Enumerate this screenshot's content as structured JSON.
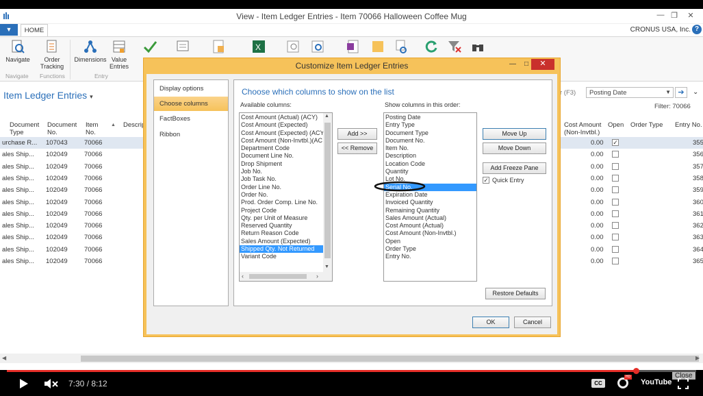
{
  "window": {
    "title": "View - Item Ledger Entries - Item 70066 Halloween Coffee Mug"
  },
  "ribbon_tabs": {
    "home": "HOME",
    "company": "CRONUS USA, Inc."
  },
  "ribbon": {
    "navigate": "Navigate",
    "order_tracking": "Order Tracking",
    "dimensions": "Dimensions",
    "value_entries": "Value Entries",
    "group_navigate": "Navigate",
    "group_functions": "Functions",
    "group_entry": "Entry"
  },
  "page": {
    "title": "Item Ledger Entries",
    "filter_hint": "r (F3)",
    "filter_field": "Posting Date",
    "filter_label": "Filter: 70066"
  },
  "grid": {
    "headers": {
      "entry_type": "Document Type",
      "doc_no": "Document No.",
      "item_no": "Item No.",
      "descr": "Descrip",
      "cost_amt": "Cost Amount (Non-Invtbl.)",
      "open": "Open",
      "order_type": "Order Type",
      "entry_no": "Entry No."
    },
    "rows": [
      {
        "type": "urchase R...",
        "doc": "107043",
        "item": "70066",
        "cost": "0.00",
        "open": true,
        "entry": "355"
      },
      {
        "type": "ales Ship...",
        "doc": "102049",
        "item": "70066",
        "cost": "0.00",
        "open": false,
        "entry": "356"
      },
      {
        "type": "ales Ship...",
        "doc": "102049",
        "item": "70066",
        "cost": "0.00",
        "open": false,
        "entry": "357"
      },
      {
        "type": "ales Ship...",
        "doc": "102049",
        "item": "70066",
        "cost": "0.00",
        "open": false,
        "entry": "358"
      },
      {
        "type": "ales Ship...",
        "doc": "102049",
        "item": "70066",
        "cost": "0.00",
        "open": false,
        "entry": "359"
      },
      {
        "type": "ales Ship...",
        "doc": "102049",
        "item": "70066",
        "cost": "0.00",
        "open": false,
        "entry": "360"
      },
      {
        "type": "ales Ship...",
        "doc": "102049",
        "item": "70066",
        "cost": "0.00",
        "open": false,
        "entry": "361"
      },
      {
        "type": "ales Ship...",
        "doc": "102049",
        "item": "70066",
        "cost": "0.00",
        "open": false,
        "entry": "362"
      },
      {
        "type": "ales Ship...",
        "doc": "102049",
        "item": "70066",
        "cost": "0.00",
        "open": false,
        "entry": "363"
      },
      {
        "type": "ales Ship...",
        "doc": "102049",
        "item": "70066",
        "cost": "0.00",
        "open": false,
        "entry": "364"
      },
      {
        "type": "ales Ship...",
        "doc": "102049",
        "item": "70066",
        "cost": "0.00",
        "open": false,
        "entry": "365"
      }
    ]
  },
  "dialog": {
    "title": "Customize Item Ledger Entries",
    "nav": [
      "Display options",
      "Choose columns",
      "FactBoxes",
      "Ribbon"
    ],
    "heading": "Choose which columns to show on the list",
    "available_label": "Available columns:",
    "shown_label": "Show columns in this order:",
    "available": [
      "Cost Amount (Actual) (ACY)",
      "Cost Amount (Expected)",
      "Cost Amount (Expected) (ACY",
      "Cost Amount (Non-Invtbl.)(AC",
      "Department Code",
      "Document Line No.",
      "Drop Shipment",
      "Job No.",
      "Job Task No.",
      "Order Line No.",
      "Order No.",
      "Prod. Order Comp. Line No.",
      "Project Code",
      "Qty. per Unit of Measure",
      "Reserved Quantity",
      "Return Reason Code",
      "Sales Amount (Expected)",
      "Shipped Qty. Not Returned",
      "Variant Code"
    ],
    "shown": [
      "Posting Date",
      "Entry Type",
      "Document Type",
      "Document No.",
      "Item No.",
      "Description",
      "Location Code",
      "Quantity",
      "Lot No.",
      "Serial No.",
      "Expiration Date",
      "Invoiced Quantity",
      "Remaining Quantity",
      "Sales Amount (Actual)",
      "Cost Amount (Actual)",
      "Cost Amount (Non-Invtbl.)",
      "Open",
      "Order Type",
      "Entry No."
    ],
    "add": "Add >>",
    "remove": "<< Remove",
    "move_up": "Move Up",
    "move_down": "Move Down",
    "add_freeze": "Add Freeze Pane",
    "quick_entry": "Quick Entry",
    "restore": "Restore Defaults",
    "ok": "OK",
    "cancel": "Cancel"
  },
  "video": {
    "time": "7:30 / 8:12",
    "close": "Close",
    "youtube": "YouTube"
  },
  "colors": {
    "accent": "#2a6fb9",
    "dialog_frame": "#f6c25a",
    "selection": "#3399ff",
    "progress": "#e52d27"
  }
}
